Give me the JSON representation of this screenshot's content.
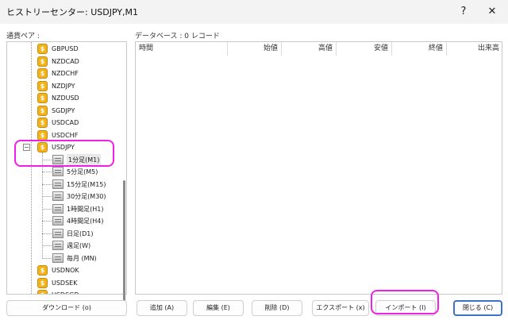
{
  "window": {
    "title": "ヒストリーセンター: USDJPY,M1",
    "help_glyph": "?",
    "close_glyph": "✕"
  },
  "labels": {
    "pairs": "通貨ペア :",
    "database": "データベース : 0 レコード"
  },
  "tree": {
    "symbols_top": [
      "GBPUSD",
      "NZDCAD",
      "NZDCHF",
      "NZDJPY",
      "NZDUSD",
      "SGDJPY",
      "USDCAD",
      "USDCHF"
    ],
    "expanded_symbol": "USDJPY",
    "expander_glyph": "−",
    "timeframes": [
      "1分足(M1)",
      "5分足(M5)",
      "15分足(M15)",
      "30分足(M30)",
      "1時間足(H1)",
      "4時間足(H4)",
      "日足(D1)",
      "週足(W)",
      "毎月 (MN)"
    ],
    "symbols_bottom": [
      "USDNOK",
      "USDSEK",
      "USDSGD"
    ]
  },
  "table": {
    "columns": [
      "時間",
      "始値",
      "高値",
      "安値",
      "終値",
      "出来高"
    ]
  },
  "buttons": {
    "download": "ダウンロード (o)",
    "add": "追加 (A)",
    "edit": "編集 (E)",
    "delete": "削除 (D)",
    "export": "エクスポート (x)",
    "import": "インポート (I)",
    "close": "閉じる (C)"
  },
  "colors": {
    "highlight": "#f020e6",
    "coin": "#f2b41c",
    "primary_border": "#3b73c8"
  }
}
